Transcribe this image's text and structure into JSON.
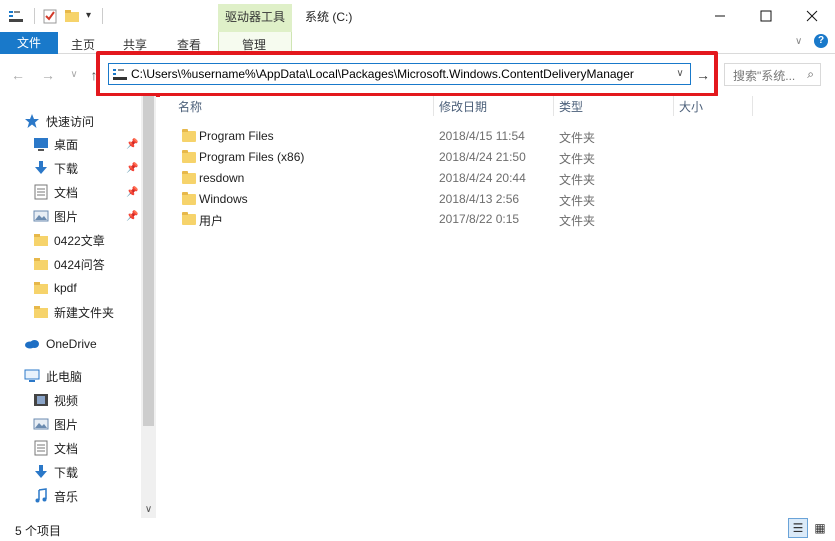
{
  "titlebar": {
    "context_tab": "驱动器工具",
    "title": "系统 (C:)",
    "minimize_icon": "minimize-icon",
    "maximize_icon": "maximize-icon",
    "close_icon": "close-icon"
  },
  "ribbon": {
    "tabs": [
      "文件",
      "主页",
      "共享",
      "查看",
      "管理"
    ]
  },
  "nav": {
    "back_icon": "←",
    "forward_icon": "→",
    "recent_icon": "∨",
    "up_icon": "↑",
    "address_value": "C:\\Users\\%username%\\AppData\\Local\\Packages\\Microsoft.Windows.ContentDeliveryManager",
    "go_icon": "→",
    "search_placeholder": "搜索\"系统...",
    "search_icon": "⌕"
  },
  "sidebar": {
    "items": [
      {
        "label": "快速访问",
        "icon": "star-icon",
        "pinned": false,
        "indent": 0
      },
      {
        "label": "桌面",
        "icon": "desktop-icon",
        "pinned": true,
        "indent": 1
      },
      {
        "label": "下载",
        "icon": "download-icon",
        "pinned": true,
        "indent": 1
      },
      {
        "label": "文档",
        "icon": "document-icon",
        "pinned": true,
        "indent": 1
      },
      {
        "label": "图片",
        "icon": "picture-icon",
        "pinned": true,
        "indent": 1
      },
      {
        "label": "0422文章",
        "icon": "folder-icon",
        "pinned": false,
        "indent": 1
      },
      {
        "label": "0424问答",
        "icon": "folder-icon",
        "pinned": false,
        "indent": 1
      },
      {
        "label": "kpdf",
        "icon": "folder-icon",
        "pinned": false,
        "indent": 1
      },
      {
        "label": "新建文件夹",
        "icon": "folder-icon",
        "pinned": false,
        "indent": 1
      },
      {
        "label": "OneDrive",
        "icon": "onedrive-icon",
        "pinned": false,
        "indent": 0
      },
      {
        "label": "此电脑",
        "icon": "computer-icon",
        "pinned": false,
        "indent": 0
      },
      {
        "label": "视频",
        "icon": "video-icon",
        "pinned": false,
        "indent": 1
      },
      {
        "label": "图片",
        "icon": "picture-icon",
        "pinned": false,
        "indent": 1
      },
      {
        "label": "文档",
        "icon": "document-icon",
        "pinned": false,
        "indent": 1
      },
      {
        "label": "下载",
        "icon": "download-icon",
        "pinned": false,
        "indent": 1
      },
      {
        "label": "音乐",
        "icon": "music-icon",
        "pinned": false,
        "indent": 1
      }
    ]
  },
  "columns": {
    "name": "名称",
    "date": "修改日期",
    "type": "类型",
    "size": "大小"
  },
  "files": [
    {
      "name": "Program Files",
      "date": "2018/4/15 11:54",
      "type": "文件夹"
    },
    {
      "name": "Program Files (x86)",
      "date": "2018/4/24 21:50",
      "type": "文件夹"
    },
    {
      "name": "resdown",
      "date": "2018/4/24 20:44",
      "type": "文件夹"
    },
    {
      "name": "Windows",
      "date": "2018/4/13 2:56",
      "type": "文件夹"
    },
    {
      "name": "用户",
      "date": "2017/8/22 0:15",
      "type": "文件夹"
    }
  ],
  "status": {
    "count": "5 个项目"
  },
  "colors": {
    "accent": "#1979ca",
    "context_tab": "#dff0c8",
    "highlight_box": "#e3181d"
  }
}
